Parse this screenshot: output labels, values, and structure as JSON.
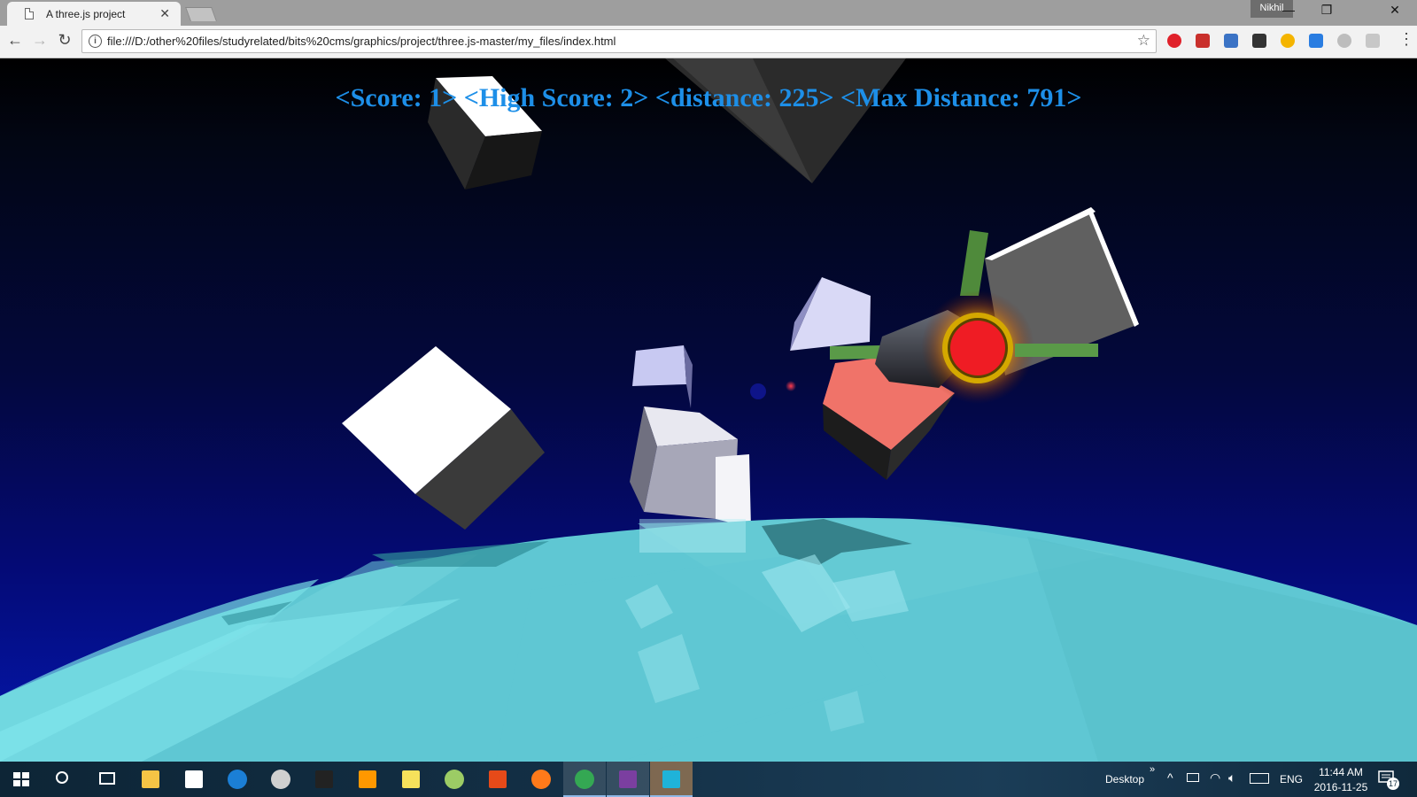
{
  "browser": {
    "tab_title": "A three.js project",
    "tab_close": "✕",
    "profile_name": "Nikhil",
    "window_controls": {
      "minimize": "—",
      "restore": "❐",
      "close": "✕"
    },
    "nav": {
      "back": "←",
      "forward": "→",
      "reload": "↻"
    },
    "url": "file:///D:/other%20files/studyrelated/bits%20cms/graphics/project/three.js-master/my_files/index.html",
    "info_glyph": "i",
    "bookmark_star": "☆",
    "extensions": [
      {
        "name": "opera-icon",
        "color": "#e0212a"
      },
      {
        "name": "red-square-icon",
        "color": "#c9302c"
      },
      {
        "name": "sync-icon",
        "color": "#3b73c5"
      },
      {
        "name": "shield-icon",
        "color": "#333333"
      },
      {
        "name": "chrome-color-icon",
        "color": "#f4b400"
      },
      {
        "name": "blue-diamond-icon",
        "color": "#2a7de1"
      },
      {
        "name": "gray-circle-icon",
        "color": "#bdbdbd"
      },
      {
        "name": "gear-gray-icon",
        "color": "#c7c7c7"
      }
    ],
    "menu_glyph": "⋮"
  },
  "game": {
    "hud_text": "<Score: 1> <High Score: 2> <distance: 225> <Max Distance: 791>",
    "hud_color": "#1d8fe8",
    "score": 1,
    "high_score": 2,
    "distance": 225,
    "max_distance": 791
  },
  "taskbar": {
    "start_icon": "windows-start-icon",
    "pinned": [
      {
        "name": "search-circle-icon",
        "color": "#ffffff"
      },
      {
        "name": "task-view-icon",
        "color": "#ffffff"
      },
      {
        "name": "file-explorer-icon",
        "color": "#f5c445"
      },
      {
        "name": "store-icon",
        "color": "#ffffff"
      },
      {
        "name": "edge-icon",
        "color": "#1b7fd6"
      },
      {
        "name": "media-player-icon",
        "color": "#d0d0d0"
      },
      {
        "name": "terminal-icon",
        "color": "#222222"
      },
      {
        "name": "sublime-text-icon",
        "color": "#ff9800"
      },
      {
        "name": "sticky-notes-icon",
        "color": "#f6e15b"
      },
      {
        "name": "app-gauge-icon",
        "color": "#9ccc65"
      },
      {
        "name": "office-lens-icon",
        "color": "#e64a19"
      },
      {
        "name": "firefox-icon",
        "color": "#ff7a1a"
      },
      {
        "name": "chrome-icon",
        "color": "#34a853"
      },
      {
        "name": "onenote-icon",
        "color": "#7b3fa0"
      },
      {
        "name": "terminal-blue-icon",
        "color": "#1fb3d9"
      }
    ],
    "desktop_label": "Desktop",
    "chevron": "»",
    "language": "ENG",
    "time": "11:44 AM",
    "date": "2016-11-25",
    "notification_count": "17"
  }
}
